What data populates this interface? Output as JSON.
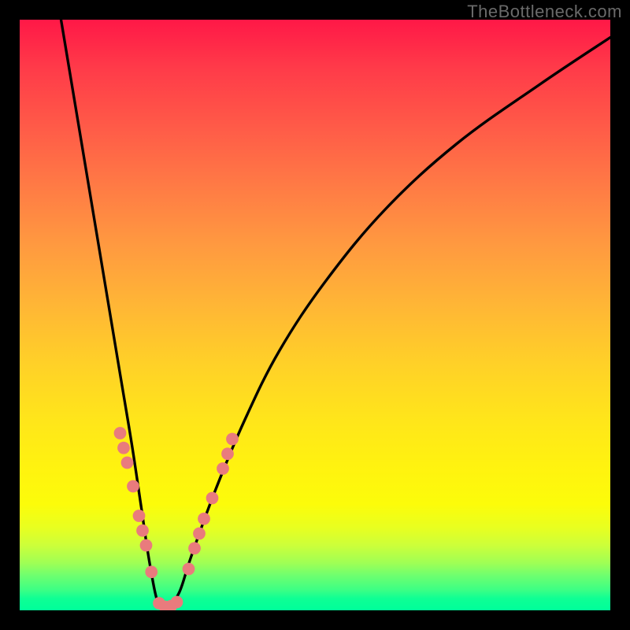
{
  "watermark": "TheBottleneck.com",
  "chart_data": {
    "type": "line",
    "title": "",
    "xlabel": "",
    "ylabel": "",
    "xlim": [
      0,
      100
    ],
    "ylim": [
      0,
      100
    ],
    "gradient_stops": [
      {
        "pct": 0,
        "color": "#ff1847"
      },
      {
        "pct": 50,
        "color": "#ffc830"
      },
      {
        "pct": 82,
        "color": "#fcfc0a"
      },
      {
        "pct": 100,
        "color": "#00ff9a"
      }
    ],
    "series": [
      {
        "name": "bottleneck-curve",
        "color": "#000000",
        "x": [
          7,
          9,
          11,
          13,
          15,
          17,
          19,
          20.5,
          22,
          23.5,
          25,
          27,
          29,
          33,
          38,
          44,
          52,
          62,
          74,
          88,
          100
        ],
        "y": [
          100,
          88,
          76,
          64,
          52,
          40,
          28,
          18,
          8,
          1,
          0.5,
          3,
          9,
          20,
          32,
          44,
          56,
          68,
          79,
          89,
          97
        ]
      }
    ],
    "marker_clusters": [
      {
        "name": "left-descent-markers",
        "color": "#e97b7d",
        "points": [
          {
            "x": 17.0,
            "y": 30.0
          },
          {
            "x": 17.6,
            "y": 27.5
          },
          {
            "x": 18.2,
            "y": 25.0
          },
          {
            "x": 19.2,
            "y": 21.0
          },
          {
            "x": 20.2,
            "y": 16.0
          },
          {
            "x": 20.8,
            "y": 13.5
          },
          {
            "x": 21.4,
            "y": 11.0
          },
          {
            "x": 22.3,
            "y": 6.5
          }
        ]
      },
      {
        "name": "trough-markers",
        "color": "#e97b7d",
        "points": [
          {
            "x": 23.6,
            "y": 1.2
          },
          {
            "x": 24.6,
            "y": 0.6
          },
          {
            "x": 25.6,
            "y": 0.7
          },
          {
            "x": 26.6,
            "y": 1.4
          }
        ]
      },
      {
        "name": "right-ascent-markers",
        "color": "#e97b7d",
        "points": [
          {
            "x": 28.6,
            "y": 7.0
          },
          {
            "x": 29.6,
            "y": 10.5
          },
          {
            "x": 30.4,
            "y": 13.0
          },
          {
            "x": 31.2,
            "y": 15.5
          },
          {
            "x": 32.6,
            "y": 19.0
          },
          {
            "x": 34.4,
            "y": 24.0
          },
          {
            "x": 35.2,
            "y": 26.5
          },
          {
            "x": 36.0,
            "y": 29.0
          }
        ]
      }
    ]
  }
}
